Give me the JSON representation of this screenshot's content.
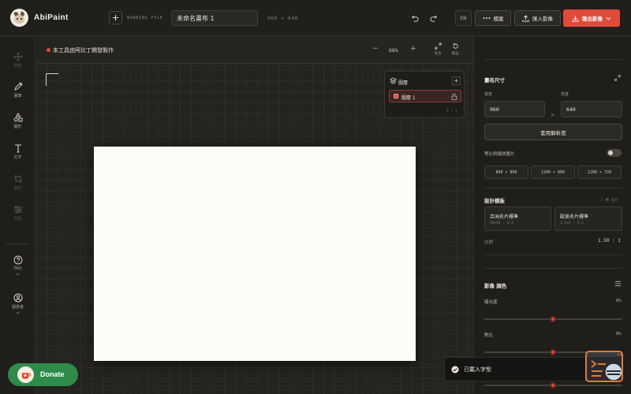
{
  "app": {
    "name": "AbiPaint"
  },
  "topbar": {
    "working_file_label": "WORKING FILE",
    "file_name": "未命名畫布 1",
    "dimensions": "960 × 640",
    "lang": "EN",
    "file_menu": "檔案",
    "import": "匯入影像",
    "export": "匯出影像"
  },
  "tools": [
    {
      "id": "move",
      "label": "移動",
      "icon": "move-icon",
      "enabled": false
    },
    {
      "id": "brush",
      "label": "畫筆",
      "icon": "brush-icon",
      "enabled": true
    },
    {
      "id": "shape",
      "label": "圖形",
      "icon": "shapes-icon",
      "enabled": true
    },
    {
      "id": "text",
      "label": "文字",
      "icon": "text-icon",
      "enabled": true
    },
    {
      "id": "crop",
      "label": "裁切",
      "icon": "crop-icon",
      "enabled": false
    },
    {
      "id": "adjust",
      "label": "調整",
      "icon": "sliders-icon",
      "enabled": false
    },
    {
      "id": "faq",
      "label": "FAQ",
      "icon": "help-icon",
      "enabled": true
    },
    {
      "id": "dev",
      "label": "開發者",
      "icon": "user-icon",
      "enabled": true
    }
  ],
  "workspace": {
    "notice": "本工具由阿比丁開發製作",
    "zoom": "68%",
    "fit_label": "符合",
    "reset_label": "重設"
  },
  "layers": {
    "title": "圖層",
    "items": [
      {
        "name": "圖層 1"
      }
    ],
    "count": "1 / 1"
  },
  "canvas_size": {
    "title": "畫布尺寸",
    "width_label": "寬度",
    "height_label": "高度",
    "width": "960",
    "height": "640",
    "times": "×",
    "apply": "套用解析度",
    "lock_ratio_label": "等比例縮放圖片",
    "lock_ratio": false,
    "presets": [
      "800 × 800",
      "1200 × 800",
      "1280 × 720"
    ]
  },
  "templates": {
    "title": "設計模板",
    "hint": "2 種 設計",
    "items": [
      {
        "name": "亞洲名片標準",
        "size": "90x54 · 4:3"
      },
      {
        "name": "歐美名片標準",
        "size": "3.5x2 · 3:2"
      }
    ],
    "ratio_label": "比例",
    "ratio_value": "1.50 : 1"
  },
  "color_adjust": {
    "title": "影像 調色",
    "sliders": [
      {
        "label": "曝光度",
        "value": "0%",
        "level": 0.5
      },
      {
        "label": "對比",
        "value": "0%",
        "level": 0.5
      },
      {
        "label": "",
        "value": "",
        "level": 0.5
      }
    ]
  },
  "toast": {
    "text": "已載入字型"
  },
  "donate": {
    "label": "Donate"
  },
  "colors": {
    "accent": "#e04a3a",
    "donate": "#2e8b4a",
    "panel": "#1f1e1b"
  }
}
